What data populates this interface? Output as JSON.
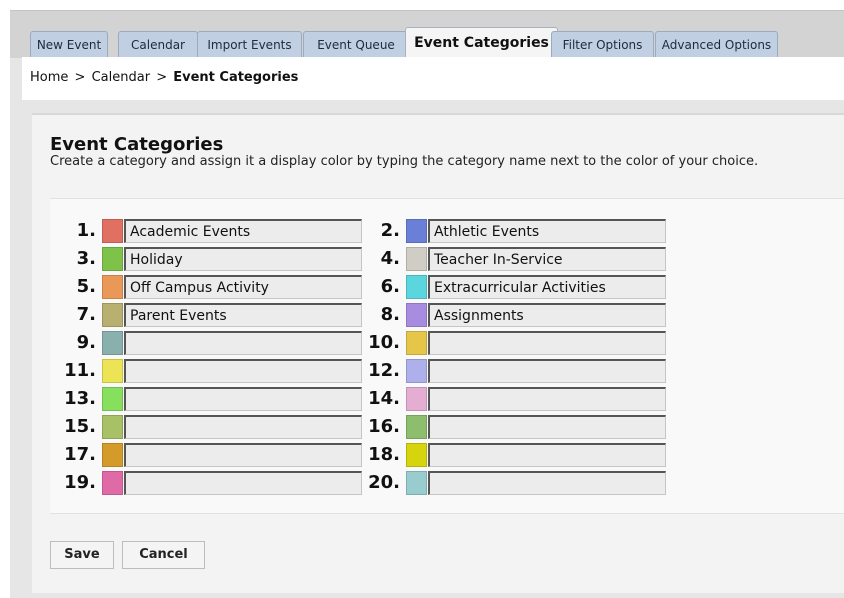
{
  "tabs": [
    {
      "label": "New Event",
      "active": false
    },
    {
      "label": "Calendar",
      "active": false
    },
    {
      "label": "Import Events",
      "active": false
    },
    {
      "label": "Event Queue",
      "active": false
    },
    {
      "label": "Event Categories",
      "active": true
    },
    {
      "label": "Filter Options",
      "active": false
    },
    {
      "label": "Advanced Options",
      "active": false
    }
  ],
  "breadcrumb": {
    "home": "Home",
    "calendar": "Calendar",
    "current": "Event Categories",
    "separator": ">"
  },
  "page": {
    "title": "Event Categories",
    "description": "Create a category and assign it a display color by typing the category name next to the color of your choice."
  },
  "categories": [
    {
      "number": "1.",
      "color": "#e07062",
      "name": "Academic Events"
    },
    {
      "number": "2.",
      "color": "#6a80d8",
      "name": "Athletic Events"
    },
    {
      "number": "3.",
      "color": "#7ec24a",
      "name": "Holiday"
    },
    {
      "number": "4.",
      "color": "#cfcdc4",
      "name": "Teacher In-Service"
    },
    {
      "number": "5.",
      "color": "#ea9858",
      "name": "Off Campus Activity"
    },
    {
      "number": "6.",
      "color": "#5bd6df",
      "name": "Extracurricular Activities"
    },
    {
      "number": "7.",
      "color": "#b8b070",
      "name": "Parent Events"
    },
    {
      "number": "8.",
      "color": "#a88ce0",
      "name": "Assignments"
    },
    {
      "number": "9.",
      "color": "#8ab0ae",
      "name": ""
    },
    {
      "number": "10.",
      "color": "#e6c648",
      "name": ""
    },
    {
      "number": "11.",
      "color": "#ece454",
      "name": ""
    },
    {
      "number": "12.",
      "color": "#aeb0ec",
      "name": ""
    },
    {
      "number": "13.",
      "color": "#86e05e",
      "name": ""
    },
    {
      "number": "14.",
      "color": "#e4aed2",
      "name": ""
    },
    {
      "number": "15.",
      "color": "#a8c066",
      "name": ""
    },
    {
      "number": "16.",
      "color": "#8cbe6e",
      "name": ""
    },
    {
      "number": "17.",
      "color": "#d49a2a",
      "name": ""
    },
    {
      "number": "18.",
      "color": "#d6d40c",
      "name": ""
    },
    {
      "number": "19.",
      "color": "#e06aa6",
      "name": ""
    },
    {
      "number": "20.",
      "color": "#98ccce",
      "name": ""
    }
  ],
  "actions": {
    "save": "Save",
    "cancel": "Cancel"
  }
}
